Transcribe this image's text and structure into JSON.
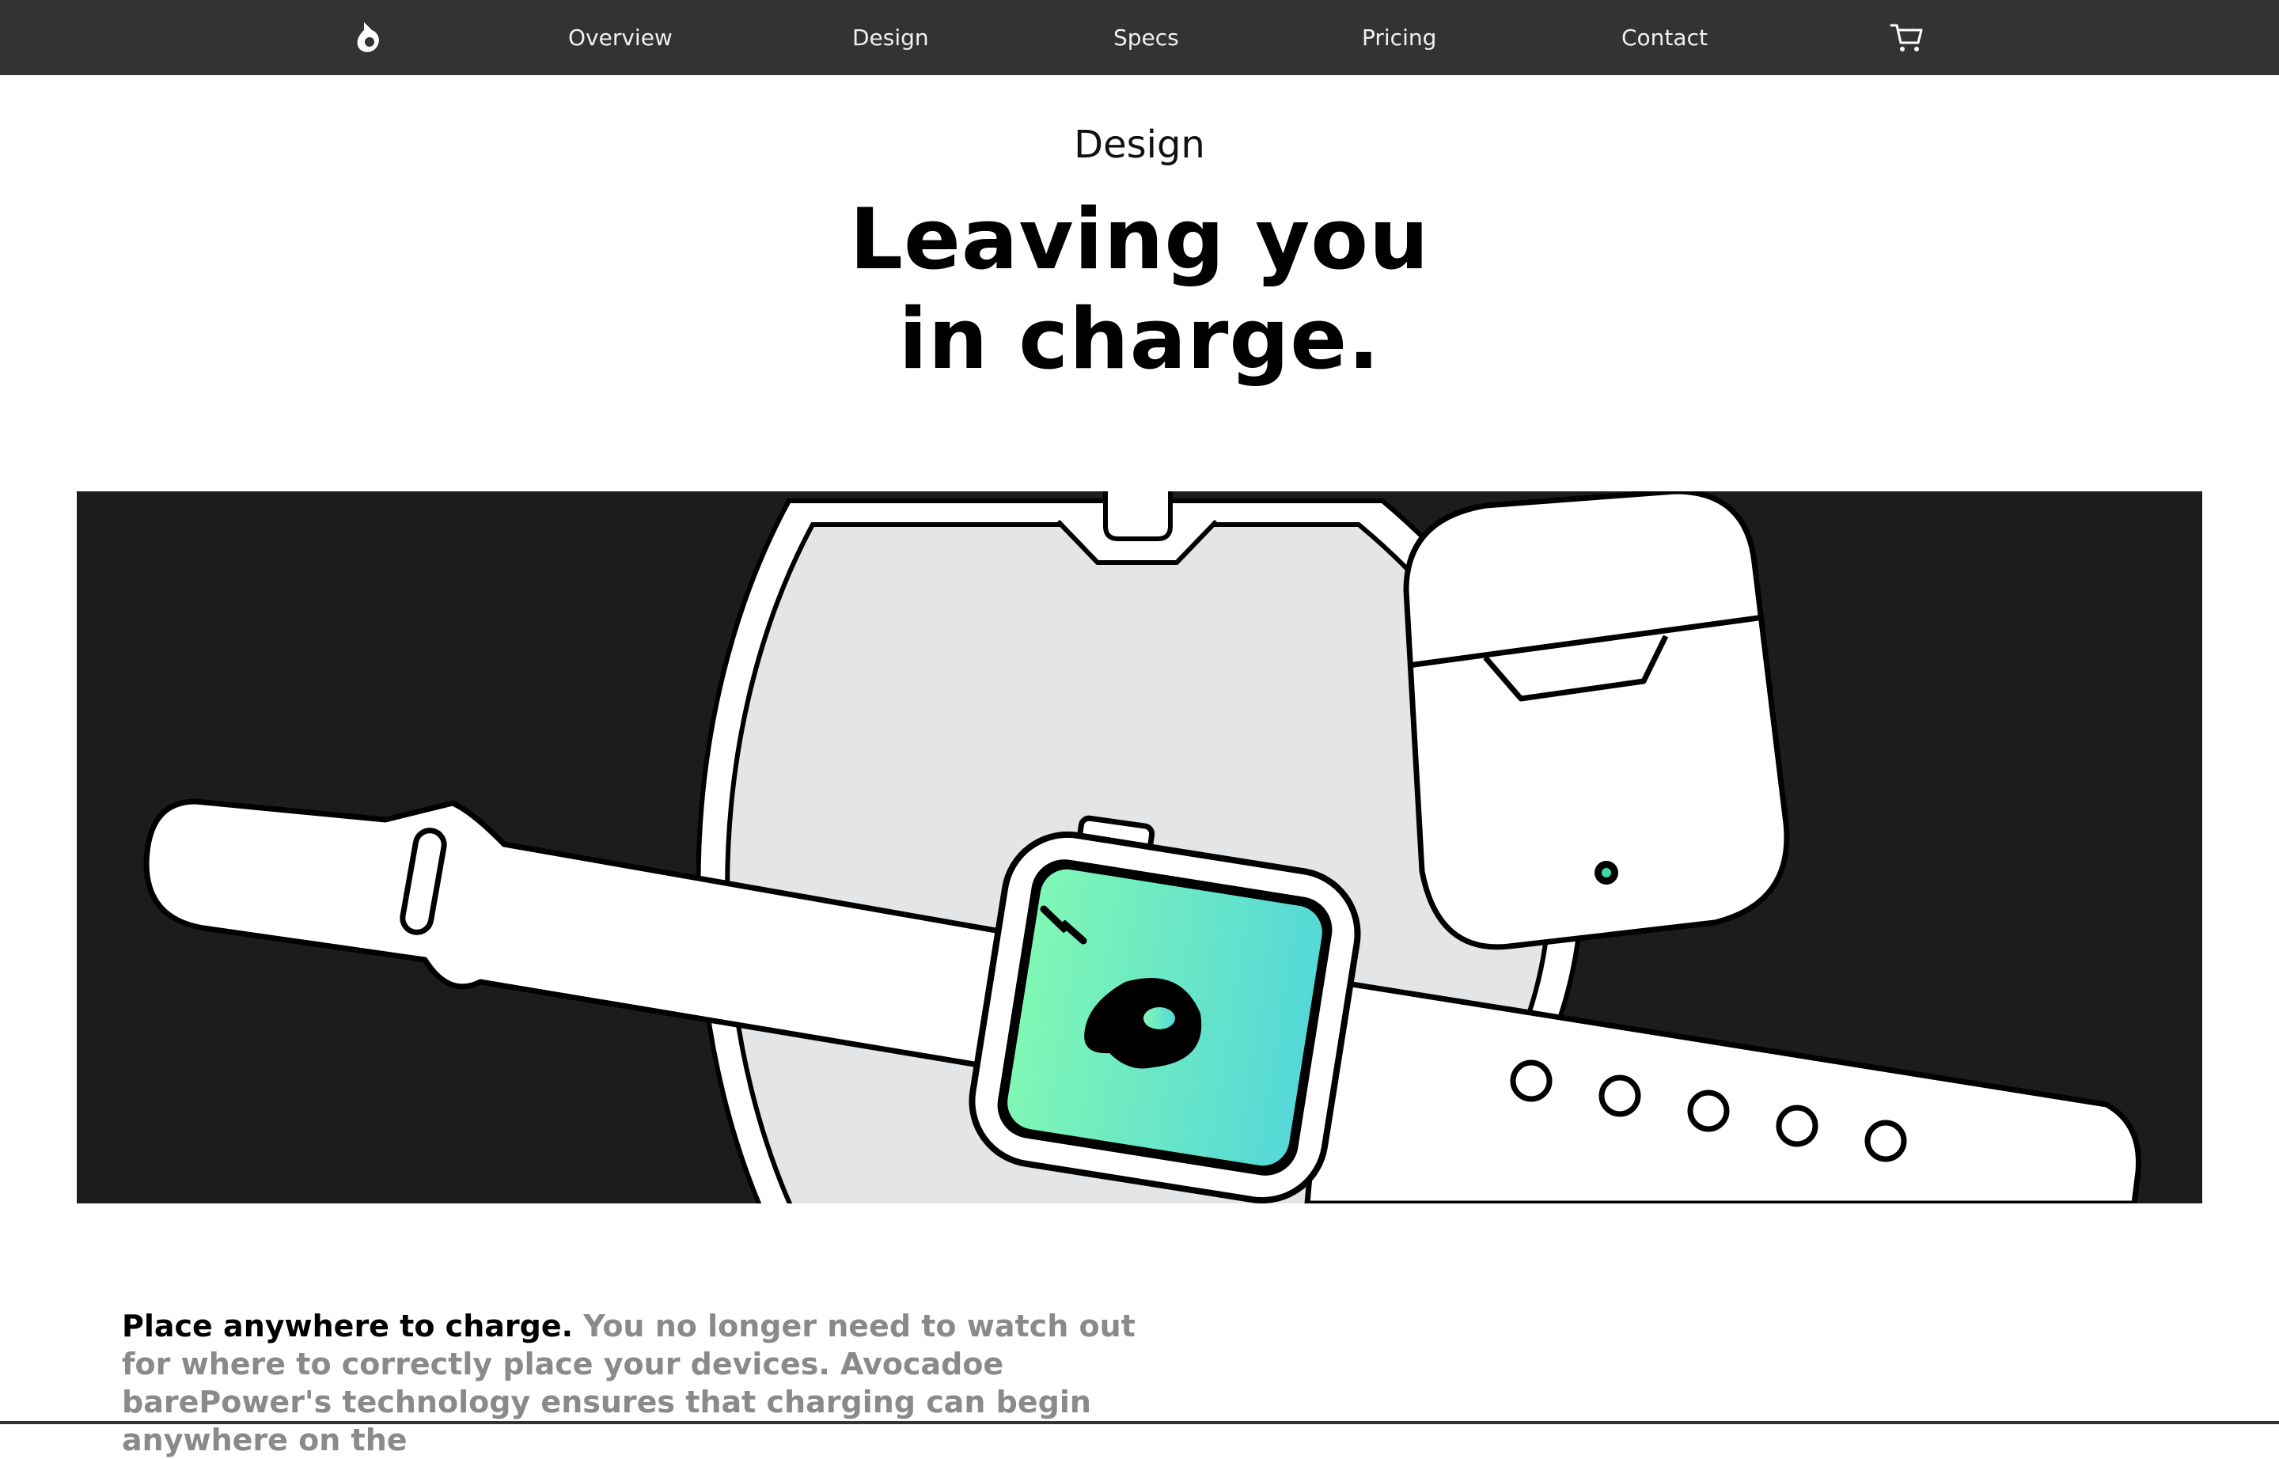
{
  "nav": {
    "items": [
      {
        "label": "Overview",
        "name": "nav-overview"
      },
      {
        "label": "Design",
        "name": "nav-design"
      },
      {
        "label": "Specs",
        "name": "nav-specs"
      },
      {
        "label": "Pricing",
        "name": "nav-pricing"
      },
      {
        "label": "Contact",
        "name": "nav-contact"
      }
    ],
    "logo_icon": "avocado-logo-icon",
    "cart_icon": "cart-icon"
  },
  "section": {
    "eyebrow": "Design",
    "headline_line1": "Leaving you",
    "headline_line2": "in charge."
  },
  "hero": {
    "image": "illustration of smartwatch and earbuds case on wireless charging pad",
    "colors": {
      "background": "#1c1c1c",
      "pad": "#e4e5e7",
      "screen_start": "#7ff7b4",
      "screen_end": "#55d8d8"
    }
  },
  "copy": {
    "lead": "Place anywhere to charge.",
    "body": "You no longer need to watch out for where to correctly place your devices. Avocadoe barePower's technology ensures that charging can begin anywhere on the"
  }
}
